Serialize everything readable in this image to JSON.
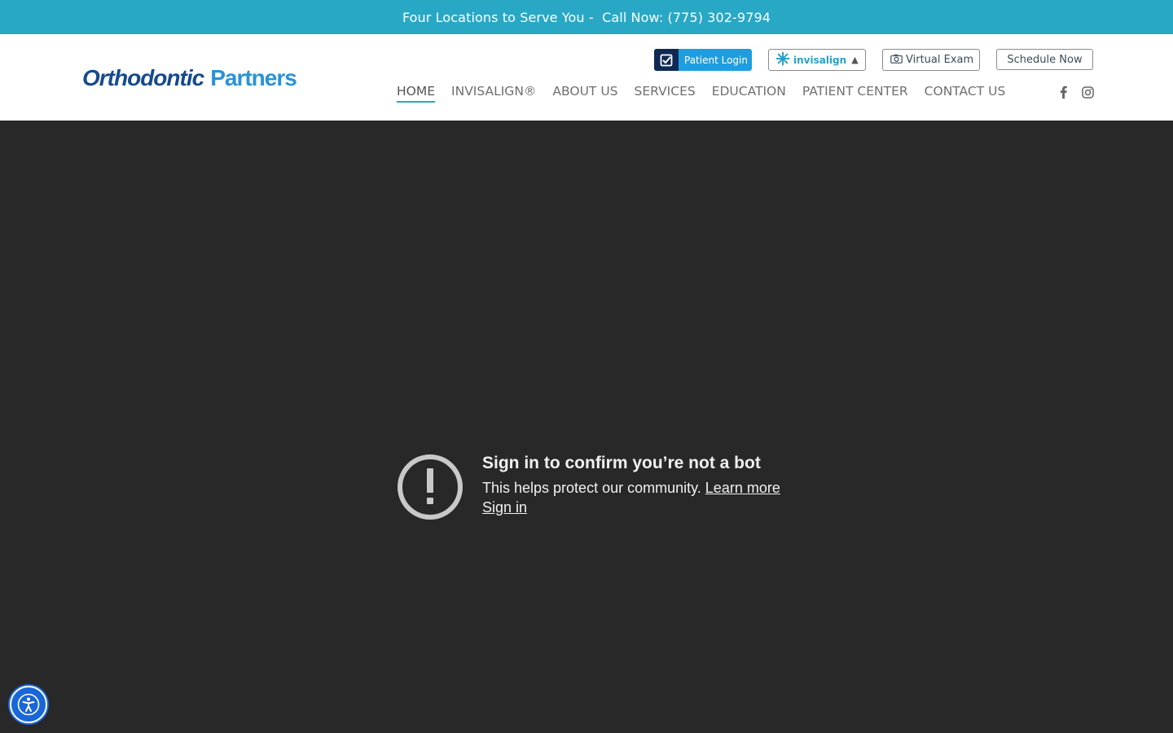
{
  "topbar": {
    "locations": "Four Locations to Serve You -",
    "call": "Call Now: (775) 302-9794"
  },
  "logo": {
    "word1": "Orthodontic",
    "word2": "Partners"
  },
  "utility": {
    "patient_login": "Patient Login",
    "invisalign": "invisalign",
    "virtual_exam": "Virtual Exam",
    "schedule_now": "Schedule Now"
  },
  "nav": {
    "items": [
      "HOME",
      "INVISALIGN®",
      "ABOUT US",
      "SERVICES",
      "EDUCATION",
      "PATIENT CENTER",
      "CONTACT US"
    ],
    "active": "HOME"
  },
  "video": {
    "title": "Sign in to confirm you’re not a bot",
    "subtitle": "This helps protect our community.",
    "learn_more": "Learn more",
    "sign_in": "Sign in"
  },
  "colors": {
    "topbar": "#29a8c6",
    "logo_dark": "#164a8c",
    "logo_light": "#2a93d6",
    "login_btn": "#1e9ee0",
    "video_bg": "#282828",
    "a11y": "#1866d8"
  },
  "icons": [
    "check-square-icon",
    "invisalign-sparkle-icon",
    "camera-icon",
    "facebook-icon",
    "instagram-icon",
    "alert-circle-icon",
    "accessibility-icon"
  ]
}
